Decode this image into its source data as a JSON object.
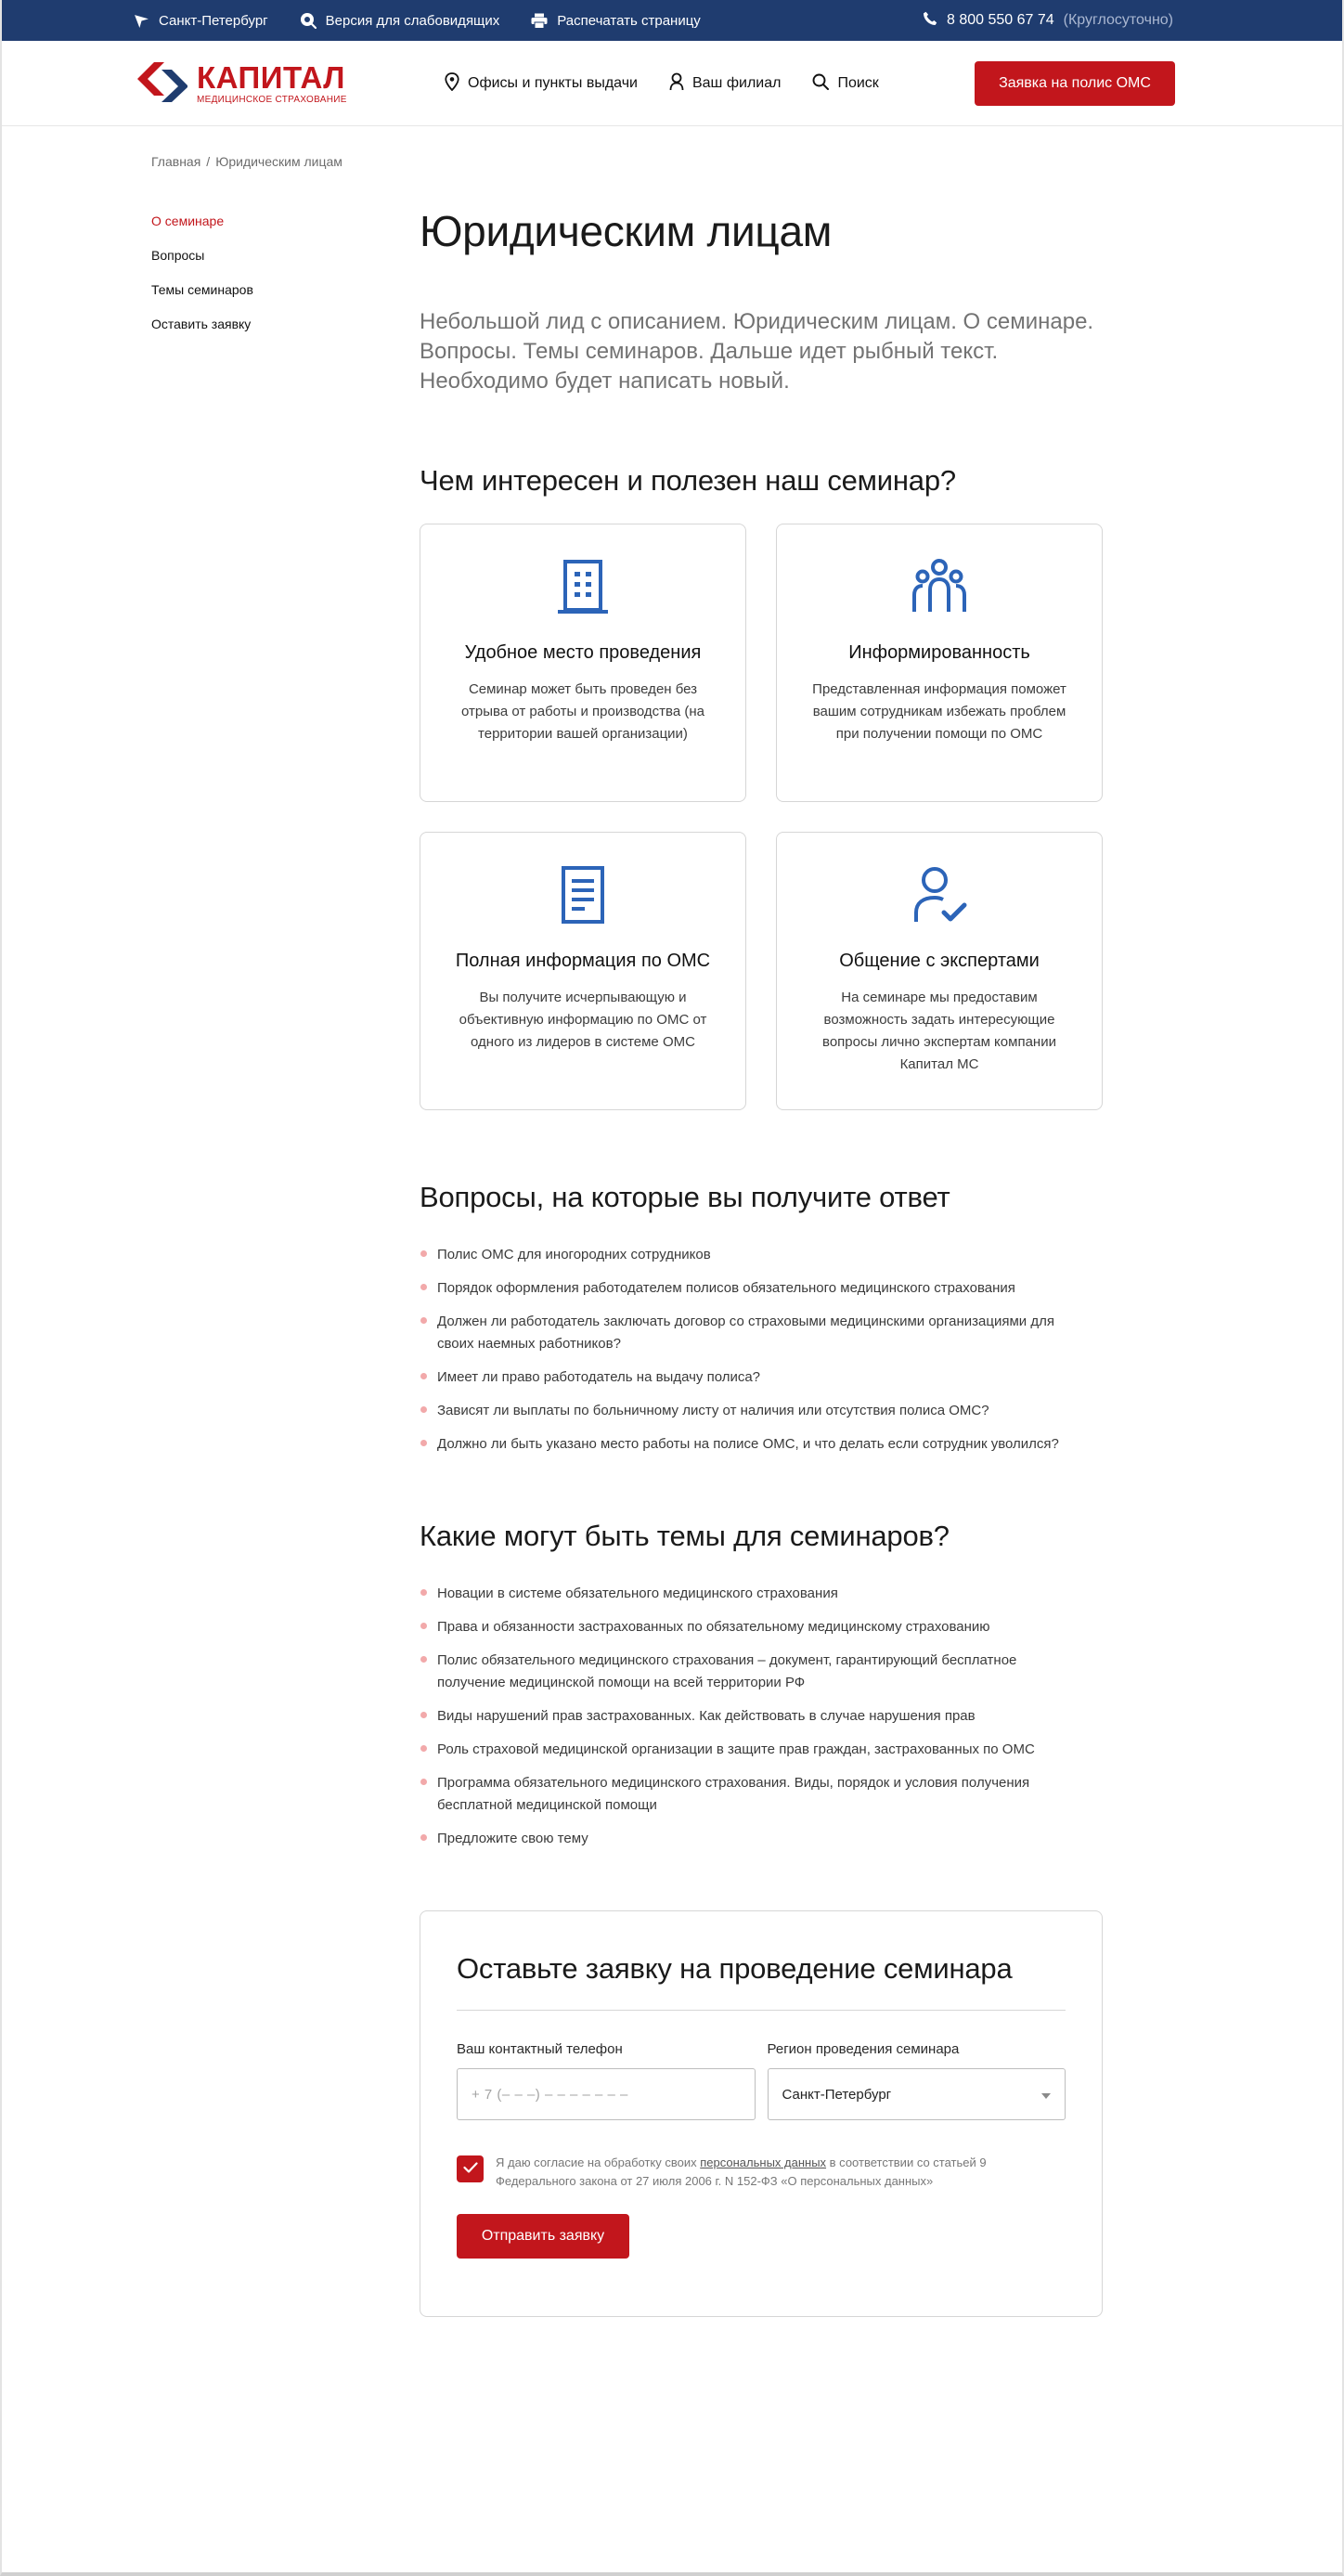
{
  "topbar": {
    "city": "Санкт-Петербург",
    "accessibility": "Версия для слабовидящих",
    "print": "Распечатать страницу",
    "phone": "8 800 550 67 74",
    "phone_hours": "(Круглосуточно)"
  },
  "header": {
    "logo_title": "КАПИТАЛ",
    "logo_subtitle": "МЕДИЦИНСКОЕ СТРАХОВАНИЕ",
    "nav": {
      "offices": "Офисы и пункты выдачи",
      "branch": "Ваш филиал",
      "search": "Поиск"
    },
    "cta": "Заявка на полис ОМС"
  },
  "breadcrumb": {
    "home": "Главная",
    "separator": "/",
    "current": "Юридическим лицам"
  },
  "sidebar": {
    "items": [
      {
        "label": "О семинаре",
        "active": true
      },
      {
        "label": "Вопросы",
        "active": false
      },
      {
        "label": "Темы семинаров",
        "active": false
      },
      {
        "label": "Оставить заявку",
        "active": false
      }
    ]
  },
  "main": {
    "title": "Юридическим лицам",
    "lead": "Небольшой лид с описанием. Юридическим лицам. О семинаре. Вопросы. Темы семинаров. Дальше идет рыбный текст. Необходимо будет написать новый.",
    "benefits_title": "Чем интересен и полезен наш семинар?",
    "cards": [
      {
        "icon": "building-icon",
        "title": "Удобное место проведения",
        "text": "Семинар может быть проведен без отрыва от работы и производства (на территории вашей организации)"
      },
      {
        "icon": "people-group-icon",
        "title": "Информированность",
        "text": "Представленная информация поможет вашим сотрудникам избежать проблем при получении помощи по ОМС"
      },
      {
        "icon": "document-icon",
        "title": "Полная информация по ОМС",
        "text": "Вы получите исчерпывающую и объективную информацию по ОМС от одного из лидеров в системе ОМС"
      },
      {
        "icon": "user-check-icon",
        "title": "Общение с экспертами",
        "text": "На семинаре мы предоставим возможность задать интересующие вопросы лично экспертам компании Капитал МС"
      }
    ],
    "questions_title": "Вопросы, на которые вы получите ответ",
    "questions": [
      "Полис ОМС для иногородних сотрудников",
      "Порядок оформления работодателем полисов обязательного медицинского страхования",
      "Должен ли работодатель заключать договор со страховыми медицинскими организациями для своих наемных работников?",
      "Имеет ли право работодатель на выдачу полиса?",
      "Зависят ли выплаты по больничному листу от наличия или отсутствия полиса ОМС?",
      "Должно ли быть указано место работы на полисе ОМС, и что делать если  сотрудник уволился?"
    ],
    "topics_title": "Какие могут быть темы для семинаров?",
    "topics": [
      "Новации в системе обязательного медицинского страхования",
      "Права и обязанности застрахованных по обязательному медицинскому страхованию",
      "Полис обязательного медицинского страхования – документ, гарантирующий бесплатное получение медицинской помощи на всей территории РФ",
      "Виды нарушений прав застрахованных. Как действовать в случае нарушения прав",
      "Роль страховой медицинской организации в защите прав граждан, застрахованных по ОМС",
      "Программа обязательного медицинского страхования. Виды, порядок и условия получения бесплатной медицинской помощи",
      "Предложите свою тему"
    ]
  },
  "form": {
    "title": "Оставьте заявку на проведение семинара",
    "phone_label": "Ваш контактный телефон",
    "phone_placeholder": "+ 7 (– – –)  – – –  – –  – –",
    "region_label": "Регион проведения семинара",
    "region_value": "Санкт-Петербург",
    "consent_before": "Я даю согласие на обработку своих ",
    "consent_link": "персональных данных",
    "consent_after": " в соответствии со статьей 9 Федерального закона от 27 июля 2006 г. N 152-ФЗ «О персональных данных»",
    "consent_checked": true,
    "submit": "Отправить заявку"
  },
  "colors": {
    "brand_red": "#c2161c",
    "topbar_blue": "#1f3c6f",
    "icon_blue": "#2c64b8",
    "bullet_pink": "#f2a9aa"
  }
}
